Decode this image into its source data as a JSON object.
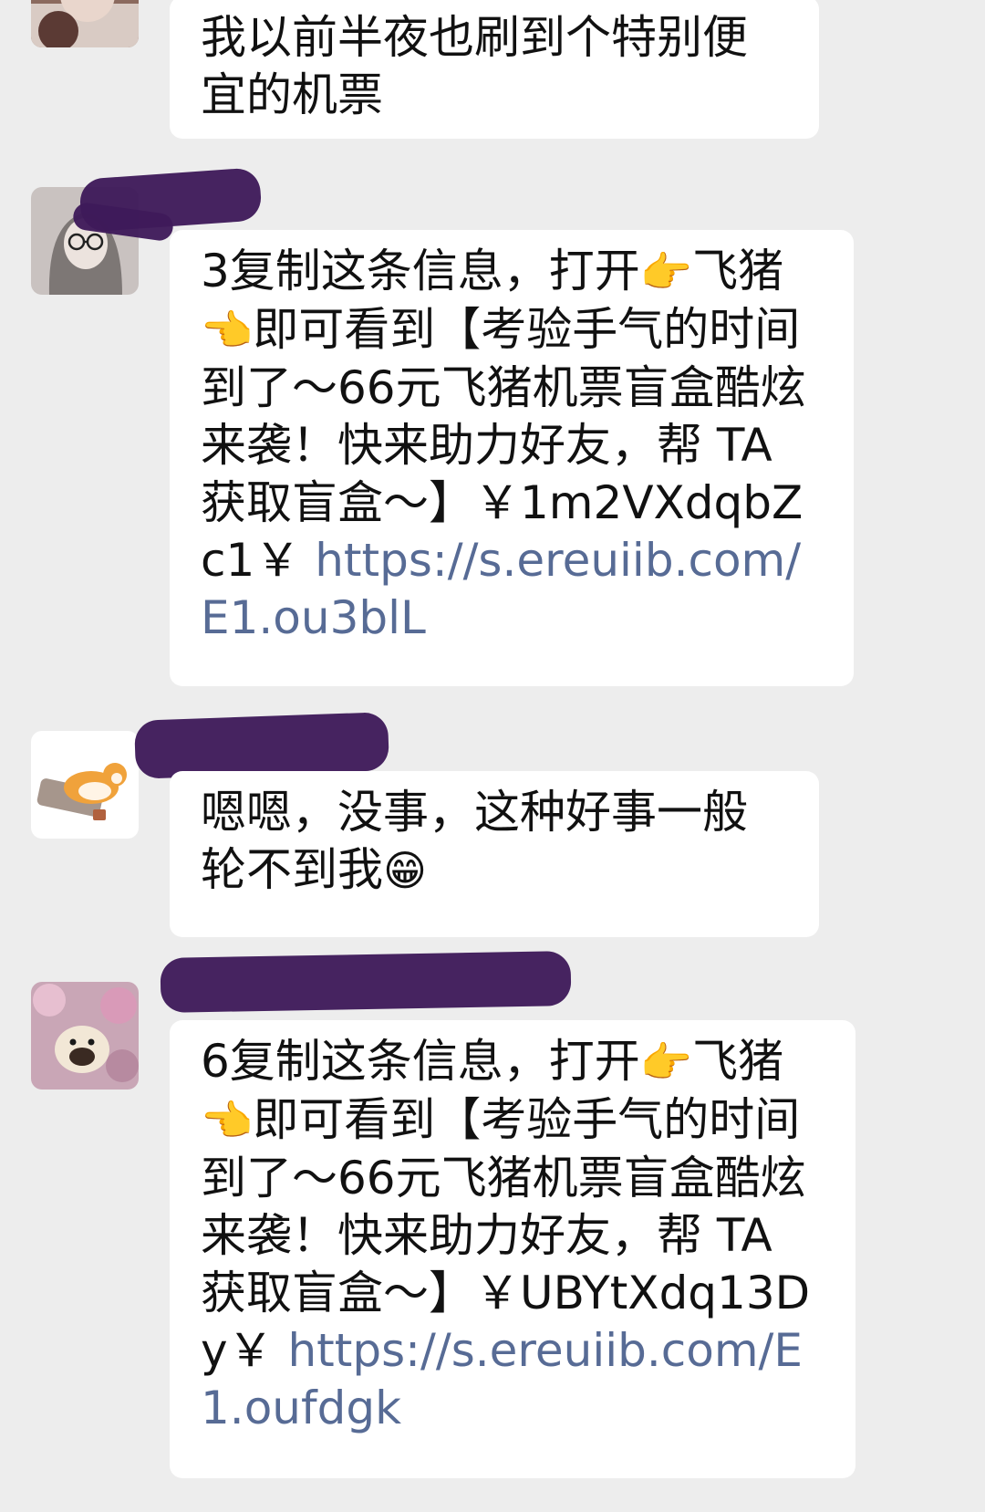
{
  "messages": [
    {
      "id": "m1",
      "text": "我以前半夜也刷到个特别便宜的机票"
    },
    {
      "id": "m2",
      "text_before": "3复制这条信息，打开",
      "emoji_a": "👉",
      "text_mid1": "飞猪",
      "emoji_b": "👈",
      "text_mid2": "即可看到【考验手气的时间到了～66元飞猪机票盲盒酷炫来袭！快来助力好友，帮 TA 获取盲盒～】￥1m2VXdqbZc1￥ ",
      "link": "https://s.ereuiib.com/E1.ou3blL"
    },
    {
      "id": "m3",
      "text": "嗯嗯，没事，这种好事一般轮不到我",
      "emoji": "😁"
    },
    {
      "id": "m4",
      "text_before": "6复制这条信息，打开",
      "emoji_a": "👉",
      "text_mid1": "飞猪",
      "emoji_b": "👈",
      "text_mid2": "即可看到【考验手气的时间到了～66元飞猪机票盲盒酷炫来袭！快来助力好友，帮 TA 获取盲盒～】￥UBYtXdq13Dy￥ ",
      "link": "https://s.ereuiib.com/E1.oufdgk"
    }
  ],
  "colors": {
    "background": "#ededed",
    "bubble": "#ffffff",
    "text": "#111111",
    "link": "#576b95",
    "redaction": "#3e1a5a"
  }
}
